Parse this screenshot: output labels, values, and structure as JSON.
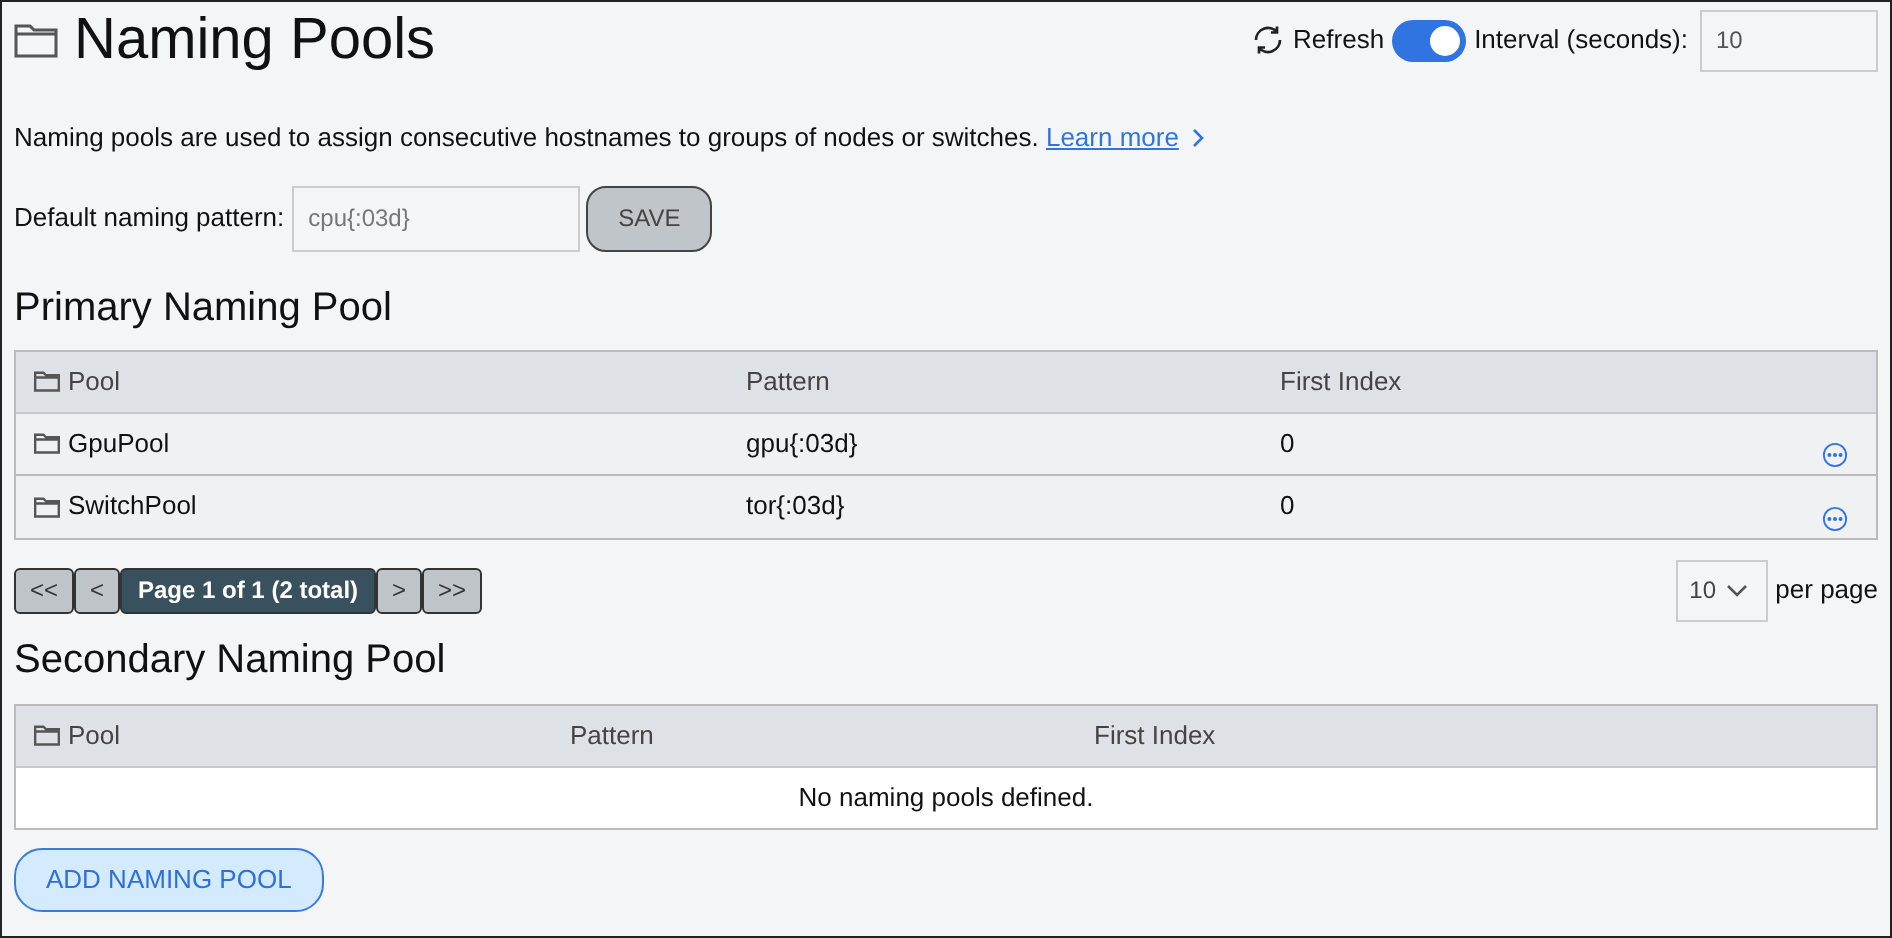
{
  "title": "Naming Pools",
  "refresh": {
    "label": "Refresh",
    "on": true,
    "interval_label": "Interval (seconds):",
    "interval_value": "10"
  },
  "description": {
    "text": "Naming pools are used to assign consecutive hostnames to groups of nodes or switches.",
    "link": "Learn more"
  },
  "default_pattern": {
    "label": "Default naming pattern:",
    "placeholder": "cpu{:03d}",
    "save": "SAVE"
  },
  "primary": {
    "heading": "Primary Naming Pool",
    "columns": [
      "Pool",
      "Pattern",
      "First Index"
    ],
    "rows": [
      {
        "pool": "GpuPool",
        "pattern": "gpu{:03d}",
        "first_index": "0"
      },
      {
        "pool": "SwitchPool",
        "pattern": "tor{:03d}",
        "first_index": "0"
      }
    ],
    "pagination": {
      "first": "<<",
      "prev": "<",
      "page": "Page 1 of 1 (2 total)",
      "next": ">",
      "last": ">>",
      "per_page_value": "10",
      "per_page_label": "per page"
    }
  },
  "secondary": {
    "heading": "Secondary Naming Pool",
    "columns": [
      "Pool",
      "Pattern",
      "First Index"
    ],
    "empty": "No naming pools defined."
  },
  "add_button": "ADD NAMING POOL"
}
